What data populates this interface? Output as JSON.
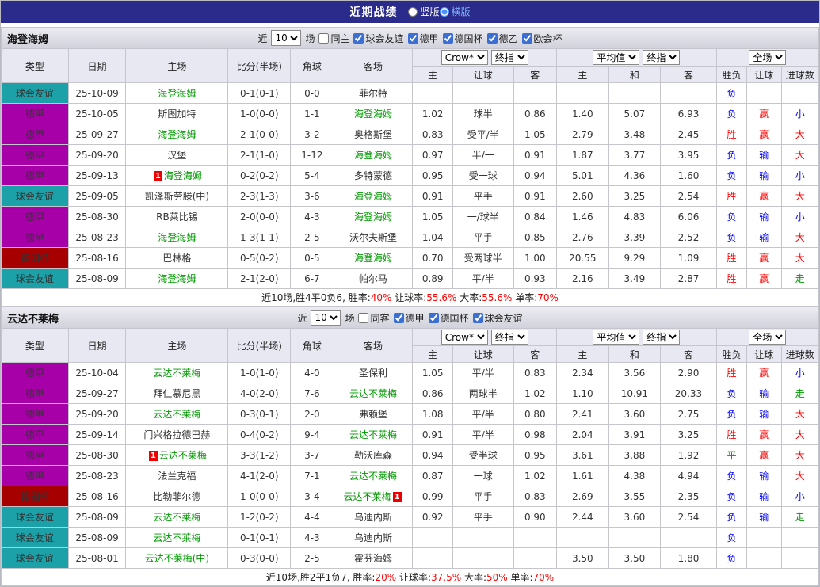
{
  "topbar": {
    "title": "近期战绩",
    "radios": [
      {
        "label": "竖版",
        "selected": false
      },
      {
        "label": "横版",
        "selected": true
      }
    ]
  },
  "header_template": {
    "main_cols": [
      "类型",
      "日期",
      "主场",
      "比分(半场)",
      "角球",
      "客场"
    ],
    "group_selects": [
      [
        "Crow*",
        "终指"
      ],
      [
        "平均值",
        "终指"
      ],
      [
        "全场"
      ]
    ],
    "sub_cols": [
      "主",
      "让球",
      "客",
      "主",
      "和",
      "客",
      "胜负",
      "让球",
      "进球数"
    ]
  },
  "colors": {
    "topbar_bg": "#2B2B8C",
    "league": {
      "球会友谊": "#1CA1A8",
      "德甲": "#A800A8",
      "德国杯": "#A60000"
    },
    "outcome": {
      "胜": "#FF0000",
      "负": "#0000FF",
      "平": "#009900",
      "赢": "#FF0000",
      "输": "#0000FF",
      "大": "#FF0000",
      "小": "#0000FF",
      "走": "#009900"
    },
    "focus_team": "#009900",
    "score": "#FF0000"
  },
  "sections": [
    {
      "team": "海登海姆",
      "filter": {
        "prefix": "近",
        "count": "10",
        "suffix": "场",
        "same": {
          "label": "同主",
          "checked": false
        },
        "leagues": [
          {
            "label": "球会友谊",
            "checked": true
          },
          {
            "label": "德甲",
            "checked": true
          },
          {
            "label": "德国杯",
            "checked": true
          },
          {
            "label": "德乙",
            "checked": true
          },
          {
            "label": "欧会杯",
            "checked": true
          }
        ]
      },
      "rows": [
        {
          "league": "球会友谊",
          "date": "25-10-09",
          "home": "海登海姆",
          "home_focus": true,
          "score": "0-1(0-1)",
          "corner": "0-0",
          "away": "菲尔特",
          "odds": [
            "",
            "",
            ""
          ],
          "avg": [
            "",
            "",
            ""
          ],
          "result": "负",
          "handicap": "",
          "goals": ""
        },
        {
          "league": "德甲",
          "date": "25-10-05",
          "home": "斯图加特",
          "score": "1-0(0-0)",
          "corner": "1-1",
          "away": "海登海姆",
          "away_focus": true,
          "odds": [
            "1.02",
            "球半",
            "0.86"
          ],
          "avg": [
            "1.40",
            "5.07",
            "6.93"
          ],
          "result": "负",
          "handicap": "赢",
          "goals": "小"
        },
        {
          "league": "德甲",
          "date": "25-09-27",
          "home": "海登海姆",
          "home_focus": true,
          "score": "2-1(0-0)",
          "corner": "3-2",
          "away": "奥格斯堡",
          "odds": [
            "0.83",
            "受平/半",
            "1.05"
          ],
          "avg": [
            "2.79",
            "3.48",
            "2.45"
          ],
          "result": "胜",
          "handicap": "赢",
          "goals": "大"
        },
        {
          "league": "德甲",
          "date": "25-09-20",
          "home": "汉堡",
          "score": "2-1(1-0)",
          "corner": "1-12",
          "away": "海登海姆",
          "away_focus": true,
          "odds": [
            "0.97",
            "半/一",
            "0.91"
          ],
          "avg": [
            "1.87",
            "3.77",
            "3.95"
          ],
          "result": "负",
          "handicap": "输",
          "goals": "大"
        },
        {
          "league": "德甲",
          "date": "25-09-13",
          "home": "海登海姆",
          "home_focus": true,
          "home_card": "1",
          "score": "0-2(0-2)",
          "corner": "5-4",
          "away": "多特蒙德",
          "odds": [
            "0.95",
            "受一球",
            "0.94"
          ],
          "avg": [
            "5.01",
            "4.36",
            "1.60"
          ],
          "result": "负",
          "handicap": "输",
          "goals": "小"
        },
        {
          "league": "球会友谊",
          "date": "25-09-05",
          "home": "凯泽斯劳滕(中)",
          "score": "2-3(1-3)",
          "corner": "3-6",
          "away": "海登海姆",
          "away_focus": true,
          "odds": [
            "0.91",
            "平手",
            "0.91"
          ],
          "avg": [
            "2.60",
            "3.25",
            "2.54"
          ],
          "result": "胜",
          "handicap": "赢",
          "goals": "大"
        },
        {
          "league": "德甲",
          "date": "25-08-30",
          "home": "RB莱比锡",
          "score": "2-0(0-0)",
          "corner": "4-3",
          "away": "海登海姆",
          "away_focus": true,
          "odds": [
            "1.05",
            "一/球半",
            "0.84"
          ],
          "avg": [
            "1.46",
            "4.83",
            "6.06"
          ],
          "result": "负",
          "handicap": "输",
          "goals": "小"
        },
        {
          "league": "德甲",
          "date": "25-08-23",
          "home": "海登海姆",
          "home_focus": true,
          "score": "1-3(1-1)",
          "corner": "2-5",
          "away": "沃尔夫斯堡",
          "odds": [
            "1.04",
            "平手",
            "0.85"
          ],
          "avg": [
            "2.76",
            "3.39",
            "2.52"
          ],
          "result": "负",
          "handicap": "输",
          "goals": "大"
        },
        {
          "league": "德国杯",
          "date": "25-08-16",
          "home": "巴林格",
          "score": "0-5(0-2)",
          "corner": "0-5",
          "away": "海登海姆",
          "away_focus": true,
          "odds": [
            "0.70",
            "受两球半",
            "1.00"
          ],
          "avg": [
            "20.55",
            "9.29",
            "1.09"
          ],
          "result": "胜",
          "handicap": "赢",
          "goals": "大"
        },
        {
          "league": "球会友谊",
          "date": "25-08-09",
          "home": "海登海姆",
          "home_focus": true,
          "score": "2-1(2-0)",
          "corner": "6-7",
          "away": "帕尔马",
          "odds": [
            "0.89",
            "平/半",
            "0.93"
          ],
          "avg": [
            "2.16",
            "3.49",
            "2.87"
          ],
          "result": "胜",
          "handicap": "赢",
          "goals": "走"
        }
      ],
      "summary": [
        {
          "text": "近10场,胜4平0负6, ",
          "color": "#222222"
        },
        {
          "text": "胜率:",
          "color": "#222222"
        },
        {
          "text": "40%",
          "color": "#FF0000"
        },
        {
          "text": " 让球率:",
          "color": "#222222"
        },
        {
          "text": "55.6%",
          "color": "#FF0000"
        },
        {
          "text": " 大率:",
          "color": "#222222"
        },
        {
          "text": "55.6%",
          "color": "#FF0000"
        },
        {
          "text": " 单率:",
          "color": "#222222"
        },
        {
          "text": "70%",
          "color": "#FF0000"
        }
      ]
    },
    {
      "team": "云达不莱梅",
      "filter": {
        "prefix": "近",
        "count": "10",
        "suffix": "场",
        "same": {
          "label": "同客",
          "checked": false
        },
        "leagues": [
          {
            "label": "德甲",
            "checked": true
          },
          {
            "label": "德国杯",
            "checked": true
          },
          {
            "label": "球会友谊",
            "checked": true
          }
        ]
      },
      "rows": [
        {
          "league": "德甲",
          "date": "25-10-04",
          "home": "云达不莱梅",
          "home_focus": true,
          "score": "1-0(1-0)",
          "corner": "4-0",
          "away": "圣保利",
          "odds": [
            "1.05",
            "平/半",
            "0.83"
          ],
          "avg": [
            "2.34",
            "3.56",
            "2.90"
          ],
          "result": "胜",
          "handicap": "赢",
          "goals": "小"
        },
        {
          "league": "德甲",
          "date": "25-09-27",
          "home": "拜仁慕尼黑",
          "score": "4-0(2-0)",
          "corner": "7-6",
          "away": "云达不莱梅",
          "away_focus": true,
          "odds": [
            "0.86",
            "两球半",
            "1.02"
          ],
          "avg": [
            "1.10",
            "10.91",
            "20.33"
          ],
          "result": "负",
          "handicap": "输",
          "goals": "走"
        },
        {
          "league": "德甲",
          "date": "25-09-20",
          "home": "云达不莱梅",
          "home_focus": true,
          "score": "0-3(0-1)",
          "corner": "2-0",
          "away": "弗赖堡",
          "odds": [
            "1.08",
            "平/半",
            "0.80"
          ],
          "avg": [
            "2.41",
            "3.60",
            "2.75"
          ],
          "result": "负",
          "handicap": "输",
          "goals": "大"
        },
        {
          "league": "德甲",
          "date": "25-09-14",
          "home": "门兴格拉德巴赫",
          "score": "0-4(0-2)",
          "corner": "9-4",
          "away": "云达不莱梅",
          "away_focus": true,
          "odds": [
            "0.91",
            "平/半",
            "0.98"
          ],
          "avg": [
            "2.04",
            "3.91",
            "3.25"
          ],
          "result": "胜",
          "handicap": "赢",
          "goals": "大"
        },
        {
          "league": "德甲",
          "date": "25-08-30",
          "home": "云达不莱梅",
          "home_focus": true,
          "home_card": "1",
          "score": "3-3(1-2)",
          "corner": "3-7",
          "away": "勒沃库森",
          "odds": [
            "0.94",
            "受半球",
            "0.95"
          ],
          "avg": [
            "3.61",
            "3.88",
            "1.92"
          ],
          "result": "平",
          "handicap": "赢",
          "goals": "大"
        },
        {
          "league": "德甲",
          "date": "25-08-23",
          "home": "法兰克福",
          "score": "4-1(2-0)",
          "corner": "7-1",
          "away": "云达不莱梅",
          "away_focus": true,
          "odds": [
            "0.87",
            "一球",
            "1.02"
          ],
          "avg": [
            "1.61",
            "4.38",
            "4.94"
          ],
          "result": "负",
          "handicap": "输",
          "goals": "大"
        },
        {
          "league": "德国杯",
          "date": "25-08-16",
          "home": "比勒菲尔德",
          "score": "1-0(0-0)",
          "corner": "3-4",
          "away": "云达不莱梅",
          "away_focus": true,
          "away_card": "1",
          "odds": [
            "0.99",
            "平手",
            "0.83"
          ],
          "avg": [
            "2.69",
            "3.55",
            "2.35"
          ],
          "result": "负",
          "handicap": "输",
          "goals": "小"
        },
        {
          "league": "球会友谊",
          "date": "25-08-09",
          "home": "云达不莱梅",
          "home_focus": true,
          "score": "1-2(0-2)",
          "corner": "4-4",
          "away": "乌迪内斯",
          "odds": [
            "0.92",
            "平手",
            "0.90"
          ],
          "avg": [
            "2.44",
            "3.60",
            "2.54"
          ],
          "result": "负",
          "handicap": "输",
          "goals": "走"
        },
        {
          "league": "球会友谊",
          "date": "25-08-09",
          "home": "云达不莱梅",
          "home_focus": true,
          "score": "0-1(0-1)",
          "corner": "4-3",
          "away": "乌迪内斯",
          "odds": [
            "",
            "",
            ""
          ],
          "avg": [
            "",
            "",
            ""
          ],
          "result": "负",
          "handicap": "",
          "goals": ""
        },
        {
          "league": "球会友谊",
          "date": "25-08-01",
          "home": "云达不莱梅(中)",
          "home_focus": true,
          "score": "0-3(0-0)",
          "corner": "2-5",
          "away": "霍芬海姆",
          "odds": [
            "",
            "",
            ""
          ],
          "avg": [
            "3.50",
            "3.50",
            "1.80"
          ],
          "result": "负",
          "handicap": "",
          "goals": ""
        }
      ],
      "summary": [
        {
          "text": "近10场,胜2平1负7, ",
          "color": "#222222"
        },
        {
          "text": "胜率:",
          "color": "#222222"
        },
        {
          "text": "20%",
          "color": "#FF0000"
        },
        {
          "text": " 让球率:",
          "color": "#222222"
        },
        {
          "text": "37.5%",
          "color": "#FF0000"
        },
        {
          "text": " 大率:",
          "color": "#222222"
        },
        {
          "text": "50%",
          "color": "#FF0000"
        },
        {
          "text": " 单率:",
          "color": "#222222"
        },
        {
          "text": "70%",
          "color": "#FF0000"
        }
      ]
    }
  ]
}
